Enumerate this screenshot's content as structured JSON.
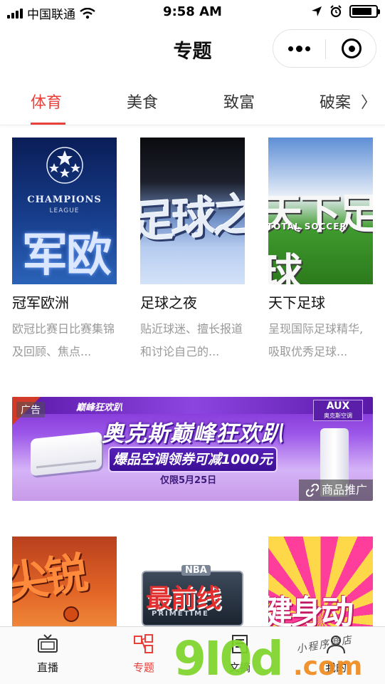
{
  "status_bar": {
    "carrier": "中国联通",
    "time": "9:58 AM",
    "battery_level": 0.85
  },
  "header": {
    "title": "专题"
  },
  "tabs": [
    {
      "label": "体育",
      "active": true
    },
    {
      "label": "美食",
      "active": false
    },
    {
      "label": "致富",
      "active": false
    },
    {
      "label": "破案",
      "active": false
    }
  ],
  "tabs_more_glyph": "〉",
  "cards": [
    {
      "title": "冠军欧洲",
      "desc": "欧冠比赛日比赛集锦及回顾、焦点...",
      "thumb_text": "军欧",
      "thumb_logo": "CHAMPIONS",
      "thumb_logo_sub": "LEAGUE"
    },
    {
      "title": "足球之夜",
      "desc": "贴近球迷、擅长报道和讨论自己的...",
      "thumb_text": "足球之"
    },
    {
      "title": "天下足球",
      "desc": "呈现国际足球精华,吸取优秀足球...",
      "thumb_text": "天下足球",
      "thumb_sub": "TOTAL SOCCER"
    }
  ],
  "ad": {
    "label": "广告",
    "slogan": "巅峰狂欢趴",
    "brand": "AUX",
    "brand_sub": "奥克斯空调",
    "headline": "奥克斯巅峰狂欢趴",
    "offer": "爆品空调领券可减1000元",
    "note": "仅限5月25日",
    "tag": "商品推广"
  },
  "row2": [
    {
      "thumb_text": "尖锐"
    },
    {
      "thumb_badge": "NBA",
      "thumb_text": "最前线",
      "thumb_sub": "PRIMETIME"
    },
    {
      "thumb_text": "健身动起"
    }
  ],
  "bottom_nav": [
    {
      "label": "直播",
      "icon": "tv-icon",
      "active": false
    },
    {
      "label": "专题",
      "icon": "topics-icon",
      "active": true
    },
    {
      "label": "文摘",
      "icon": "digest-icon",
      "active": false
    },
    {
      "label": "我的",
      "icon": "user-icon",
      "active": false
    }
  ],
  "watermark": {
    "number": "9I0d",
    "domain": ".com",
    "handwriting": "小程序商店"
  },
  "colors": {
    "accent": "#e8413c",
    "muted_text": "#999999"
  }
}
